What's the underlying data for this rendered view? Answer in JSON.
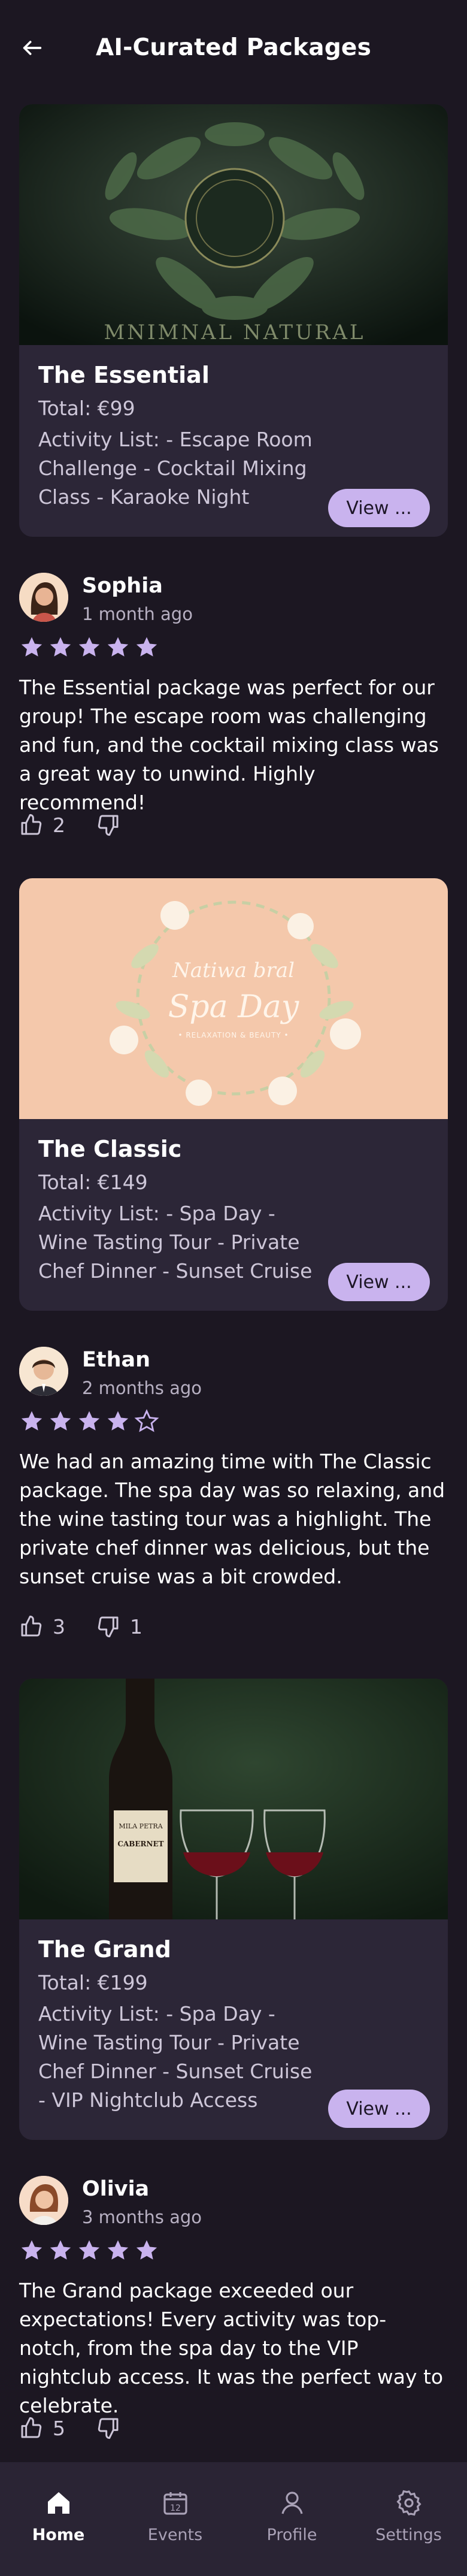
{
  "header": {
    "title": "AI-Curated Packages",
    "back_icon": "arrow-left-icon"
  },
  "colors": {
    "background": "#1c1722",
    "card": "#2c2637",
    "accent": "#c9b3ee",
    "star": "#c9b3ee",
    "nav": "#2a2434"
  },
  "packages": [
    {
      "image_caption": "MNIMNAL  NATURAL",
      "title": "The Essential",
      "price": "Total: €99",
      "activities": "Activity List: - Escape Room Challenge - Cocktail Mixing Class - Karaoke Night",
      "button": "View ..."
    },
    {
      "image_caption": "Natiwa bral",
      "image_title": "Spa Day",
      "image_subtitle": "• RELAXATION & BEAUTY •",
      "title": "The Classic",
      "price": "Total: €149",
      "activities": "Activity List: - Spa Day - Wine Tasting Tour - Private Chef Dinner - Sunset Cruise",
      "button": "View ..."
    },
    {
      "image_label_top": "MILA PETRA",
      "image_label_main": "CABERNET",
      "title": "The Grand",
      "price": "Total: €199",
      "activities": "Activity List: - Spa Day - Wine Tasting Tour - Private Chef Dinner - Sunset Cruise - VIP Nightclub Access",
      "button": "View ..."
    }
  ],
  "reviews": [
    {
      "name": "Sophia",
      "date": "1 month ago",
      "rating": 5,
      "text": "The Essential package was perfect for our group! The escape room was challenging and fun, and the cocktail mixing class was a great way to unwind. Highly recommend!",
      "likes": "2",
      "dislikes": ""
    },
    {
      "name": "Ethan",
      "date": "2 months ago",
      "rating": 4,
      "text": "We had an amazing time with The Classic package. The spa day was so relaxing, and the wine tasting tour was a highlight. The private chef dinner was delicious, but the sunset cruise was a bit crowded.",
      "likes": "3",
      "dislikes": "1"
    },
    {
      "name": "Olivia",
      "date": "3 months ago",
      "rating": 5,
      "text": "The Grand package exceeded our expectations! Every activity was top-notch, from the spa day to the VIP nightclub access. It was the perfect way to celebrate.",
      "likes": "5",
      "dislikes": ""
    }
  ],
  "nav": {
    "items": [
      {
        "label": "Home",
        "icon": "home-icon",
        "active": true
      },
      {
        "label": "Events",
        "icon": "calendar-icon",
        "active": false
      },
      {
        "label": "Profile",
        "icon": "user-icon",
        "active": false
      },
      {
        "label": "Settings",
        "icon": "gear-icon",
        "active": false
      }
    ]
  }
}
